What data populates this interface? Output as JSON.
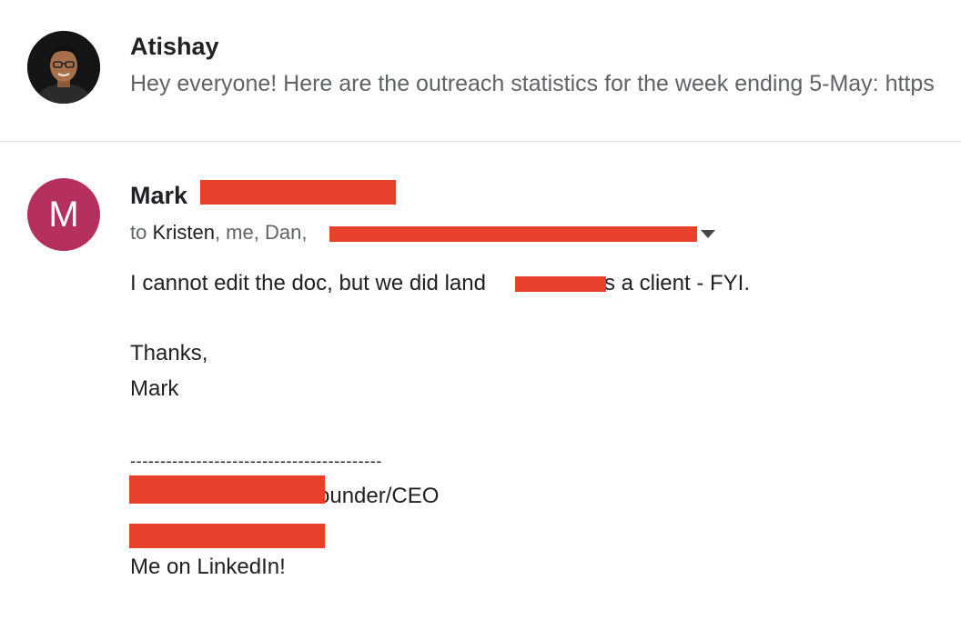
{
  "colors": {
    "redaction": "#e8412b",
    "avatar_m_bg": "#b5305f",
    "muted_text": "#5f6368",
    "primary_text": "#202124"
  },
  "collapsed_message": {
    "sender": "Atishay",
    "snippet": "Hey everyone! Here are the outreach statistics for the week ending 5-May: https",
    "avatar": "profile-photo"
  },
  "expanded_message": {
    "avatar_letter": "M",
    "sender_name": "Mark",
    "recipients_prefix": "to ",
    "recipient_first": "Kristen",
    "recipients_rest": ", me, Dan, ",
    "body": {
      "line1_before": "I cannot edit the doc, but we did land",
      "line1_after": " as a client - FYI.",
      "thanks": "Thanks,",
      "signoff": "Mark",
      "divider": "------------------------------------------",
      "signature_title": "ounder/CEO",
      "linkedin": "Me on LinkedIn!"
    }
  }
}
